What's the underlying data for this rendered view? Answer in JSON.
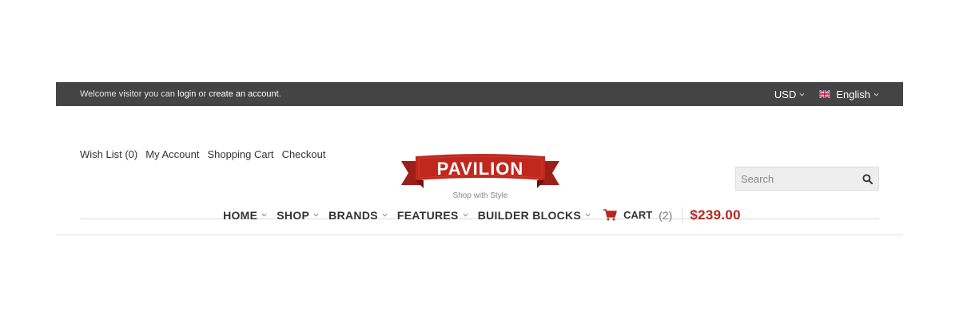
{
  "colors": {
    "topbar_bg": "#444444",
    "accent": "#b5261e",
    "search_bg": "#eeeeee"
  },
  "topbar": {
    "welcome_prefix": "Welcome visitor you can ",
    "login_label": "login",
    "welcome_middle": " or ",
    "create_account_label": "create an account",
    "welcome_suffix": ".",
    "currency": "USD",
    "language": "English"
  },
  "header": {
    "links": [
      "Wish List (0)",
      "My Account",
      "Shopping Cart",
      "Checkout"
    ],
    "logo": {
      "name": "PAVILION",
      "tagline": "Shop with Style"
    },
    "search": {
      "placeholder": "Search",
      "icon": "search-icon"
    }
  },
  "nav": {
    "items": [
      "HOME",
      "SHOP",
      "BRANDS",
      "FEATURES",
      "BUILDER BLOCKS"
    ],
    "cart": {
      "label": "CART",
      "count": "(2)",
      "icon": "cart-icon"
    },
    "total": "$239.00"
  }
}
